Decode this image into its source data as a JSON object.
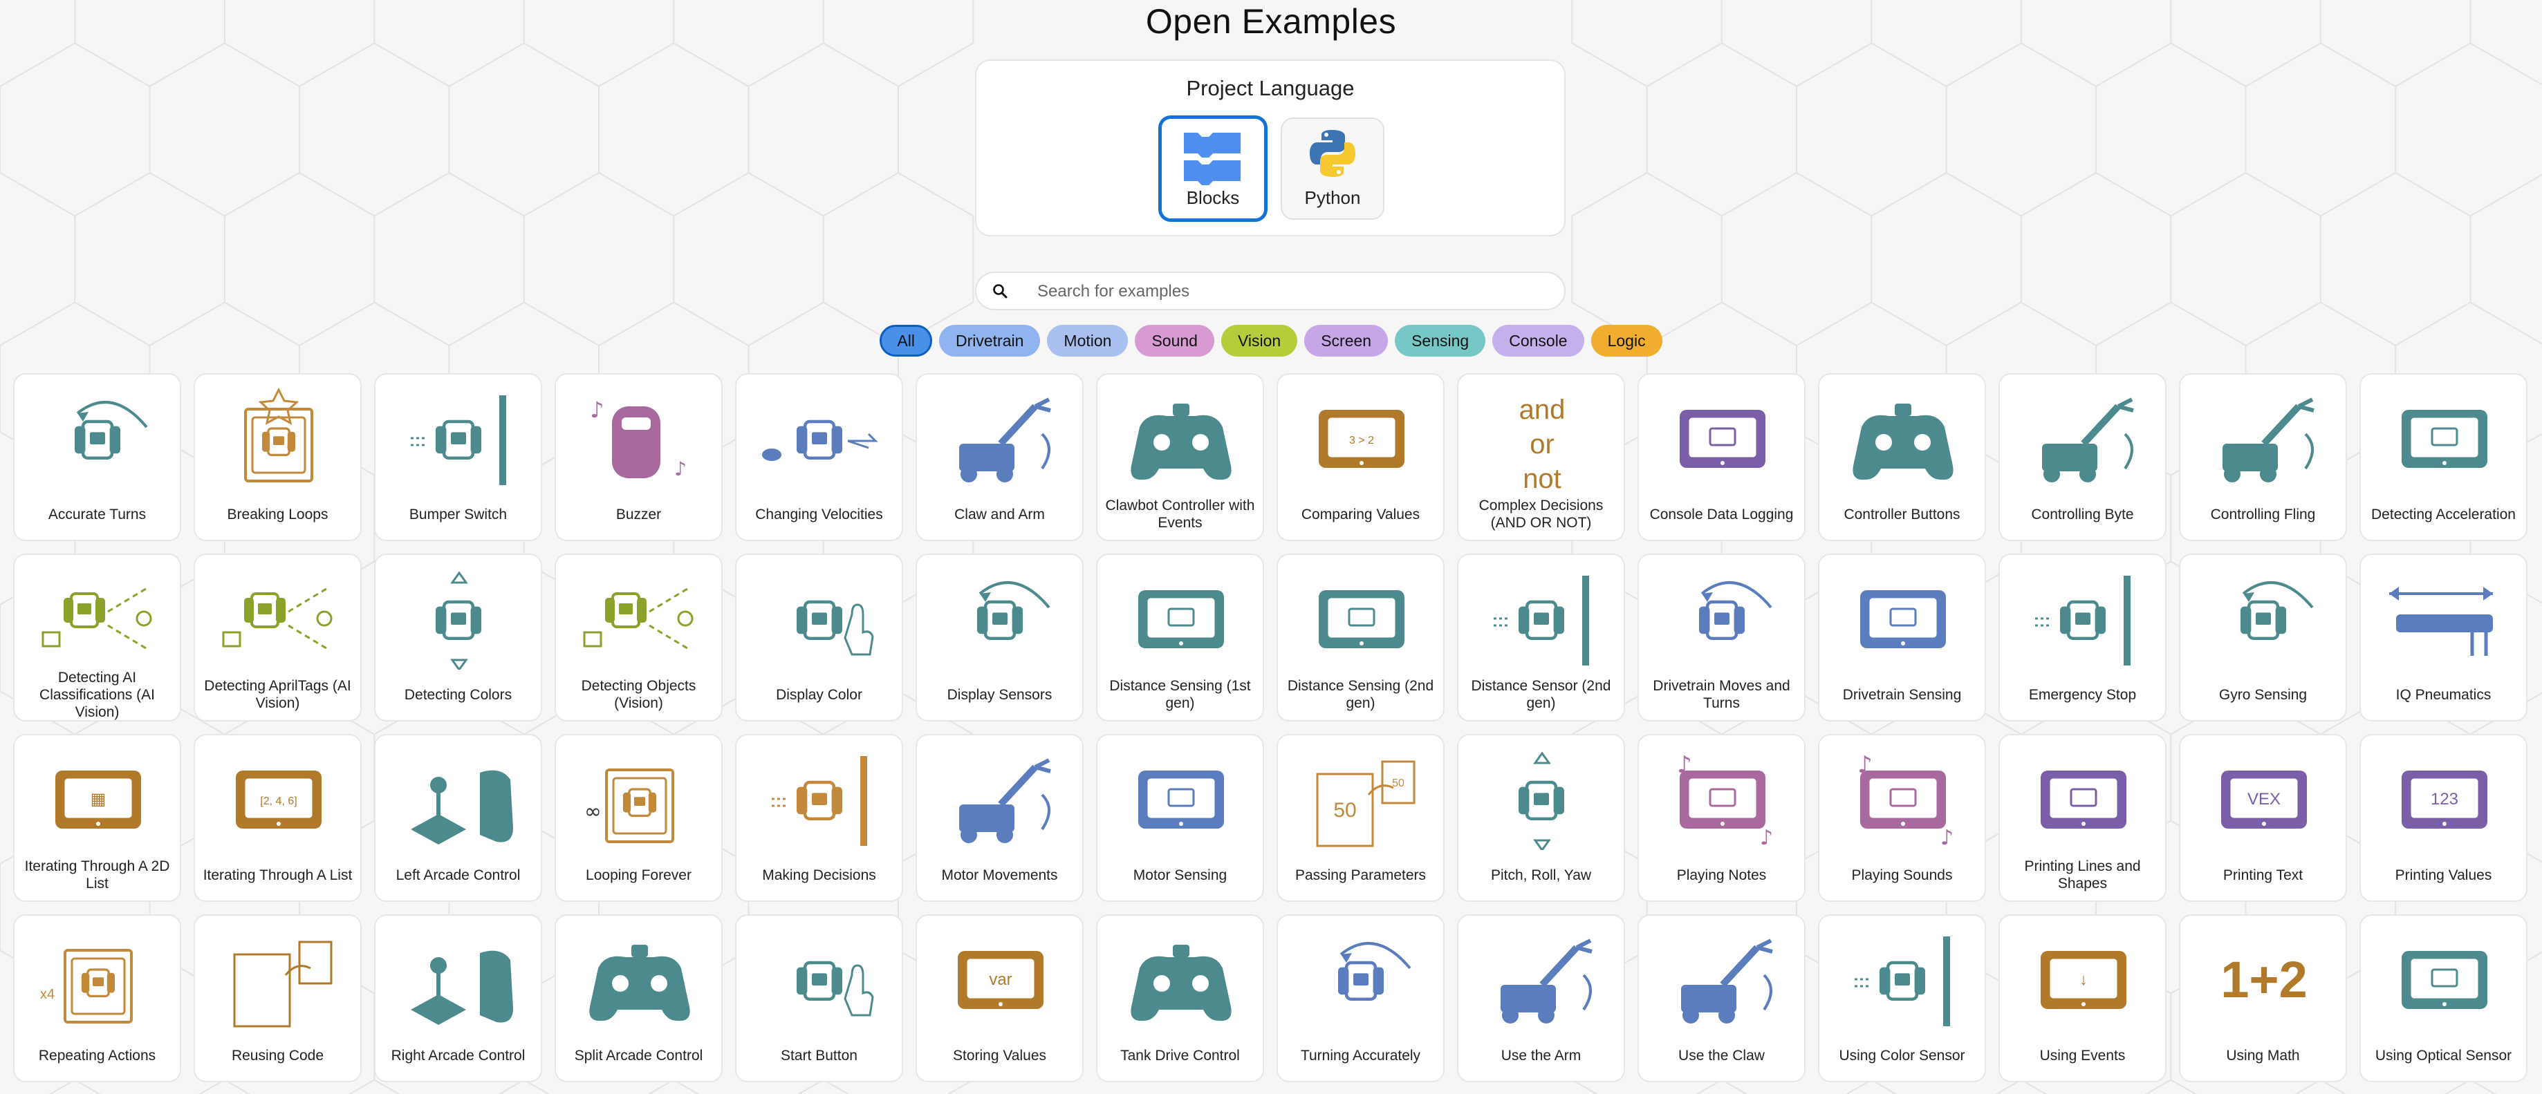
{
  "page_title": "Open Examples",
  "language": {
    "title": "Project Language",
    "options": [
      {
        "label": "Blocks",
        "selected": true
      },
      {
        "label": "Python",
        "selected": false
      }
    ]
  },
  "search": {
    "placeholder": "Search for examples",
    "value": ""
  },
  "filters": [
    {
      "label": "All",
      "color": "#4a90e8",
      "active": true
    },
    {
      "label": "Drivetrain",
      "color": "#8fb4f0",
      "active": false
    },
    {
      "label": "Motion",
      "color": "#a9bff0",
      "active": false
    },
    {
      "label": "Sound",
      "color": "#d79ad3",
      "active": false
    },
    {
      "label": "Vision",
      "color": "#b6cc3a",
      "active": false
    },
    {
      "label": "Screen",
      "color": "#c7a6e8",
      "active": false
    },
    {
      "label": "Sensing",
      "color": "#76c8c6",
      "active": false
    },
    {
      "label": "Console",
      "color": "#c4b0ec",
      "active": false
    },
    {
      "label": "Logic",
      "color": "#f0ad2e",
      "active": false
    }
  ],
  "examples": [
    {
      "name": "Accurate Turns",
      "icon": "turn-robot-icon",
      "color": "#4c8a8e"
    },
    {
      "name": "Breaking Loops",
      "icon": "loop-break-icon",
      "color": "#c2893b"
    },
    {
      "name": "Bumper Switch",
      "icon": "bumper-robot-icon",
      "color": "#4c8a8e"
    },
    {
      "name": "Buzzer",
      "icon": "buzzer-icon",
      "color": "#a86a9e"
    },
    {
      "name": "Changing Velocities",
      "icon": "velocity-robot-icon",
      "color": "#5b7dbd"
    },
    {
      "name": "Claw and Arm",
      "icon": "claw-arm-icon",
      "color": "#5b7dbd"
    },
    {
      "name": "Clawbot Controller with Events",
      "icon": "controller-icon",
      "color": "#4c8a8e"
    },
    {
      "name": "Comparing Values",
      "icon": "brain-screen-icon",
      "color": "#b07a2a",
      "screen_text": "3 > 2"
    },
    {
      "name": "Complex Decisions (AND OR NOT)",
      "icon": "logic-words-icon",
      "color": "#b07a2a",
      "words": [
        "and",
        "or",
        "not"
      ]
    },
    {
      "name": "Console Data Logging",
      "icon": "brain-screen-icon",
      "color": "#7b5ea8",
      "screen_text": ""
    },
    {
      "name": "Controller Buttons",
      "icon": "controller-icon",
      "color": "#4c8a8e"
    },
    {
      "name": "Controlling Byte",
      "icon": "byte-robot-icon",
      "color": "#4c8a8e"
    },
    {
      "name": "Controlling Fling",
      "icon": "fling-robot-icon",
      "color": "#4c8a8e"
    },
    {
      "name": "Detecting Acceleration",
      "icon": "brain-screen-icon",
      "color": "#4c8a8e",
      "screen_text": ""
    },
    {
      "name": "Detecting AI Classifications (AI Vision)",
      "icon": "ai-vision-icon",
      "color": "#8aa22a"
    },
    {
      "name": "Detecting AprilTags (AI Vision)",
      "icon": "ai-vision-icon",
      "color": "#8aa22a"
    },
    {
      "name": "Detecting Colors",
      "icon": "color-sensor-robot-icon",
      "color": "#4c8a8e"
    },
    {
      "name": "Detecting Objects (Vision)",
      "icon": "ai-vision-icon",
      "color": "#8aa22a"
    },
    {
      "name": "Display Color",
      "icon": "touch-robot-icon",
      "color": "#4c8a8e"
    },
    {
      "name": "Display Sensors",
      "icon": "gyro-robot-icon",
      "color": "#4c8a8e"
    },
    {
      "name": "Distance Sensing (1st gen)",
      "icon": "brain-screen-icon",
      "color": "#4c8a8e",
      "screen_text": ""
    },
    {
      "name": "Distance Sensing (2nd gen)",
      "icon": "brain-screen-icon",
      "color": "#4c8a8e",
      "screen_text": ""
    },
    {
      "name": "Distance Sensor (2nd gen)",
      "icon": "distance-robot-icon",
      "color": "#4c8a8e"
    },
    {
      "name": "Drivetrain Moves and Turns",
      "icon": "turn-robot-icon",
      "color": "#5b7dbd"
    },
    {
      "name": "Drivetrain Sensing",
      "icon": "brain-screen-icon",
      "color": "#5b7dbd",
      "screen_text": ""
    },
    {
      "name": "Emergency Stop",
      "icon": "bumper-robot-icon",
      "color": "#4c8a8e"
    },
    {
      "name": "Gyro Sensing",
      "icon": "gyro-robot-icon",
      "color": "#4c8a8e"
    },
    {
      "name": "IQ Pneumatics",
      "icon": "pneumatics-icon",
      "color": "#5b7dbd"
    },
    {
      "name": "Iterating Through A 2D List",
      "icon": "brain-screen-icon",
      "color": "#b07a2a",
      "screen_text": "▦"
    },
    {
      "name": "Iterating Through A List",
      "icon": "brain-screen-icon",
      "color": "#b07a2a",
      "screen_text": "[2, 4, 6]"
    },
    {
      "name": "Left Arcade Control",
      "icon": "joystick-icon",
      "color": "#4c8a8e"
    },
    {
      "name": "Looping Forever",
      "icon": "loop-forever-icon",
      "color": "#c2893b"
    },
    {
      "name": "Making Decisions",
      "icon": "bumper-robot-icon",
      "color": "#c2893b"
    },
    {
      "name": "Motor Movements",
      "icon": "arm-motion-icon",
      "color": "#5b7dbd"
    },
    {
      "name": "Motor Sensing",
      "icon": "brain-screen-icon",
      "color": "#5b7dbd",
      "screen_text": ""
    },
    {
      "name": "Passing Parameters",
      "icon": "document-icon",
      "color": "#c2893b",
      "screen_text": "50"
    },
    {
      "name": "Pitch, Roll, Yaw",
      "icon": "pitch-robot-icon",
      "color": "#4c8a8e"
    },
    {
      "name": "Playing Notes",
      "icon": "sound-screen-icon",
      "color": "#a86a9e"
    },
    {
      "name": "Playing Sounds",
      "icon": "sound-screen-icon",
      "color": "#a86a9e"
    },
    {
      "name": "Printing Lines and Shapes",
      "icon": "brain-screen-icon",
      "color": "#7b5ea8",
      "screen_text": ""
    },
    {
      "name": "Printing Text",
      "icon": "brain-screen-icon",
      "color": "#7b5ea8",
      "screen_text": "VEX"
    },
    {
      "name": "Printing Values",
      "icon": "brain-screen-icon",
      "color": "#7b5ea8",
      "screen_text": "123"
    },
    {
      "name": "Repeating Actions",
      "icon": "loop-repeat-icon",
      "color": "#c2893b"
    },
    {
      "name": "Reusing Code",
      "icon": "document-icon",
      "color": "#b07a2a",
      "screen_text": ""
    },
    {
      "name": "Right Arcade Control",
      "icon": "joystick-icon",
      "color": "#4c8a8e"
    },
    {
      "name": "Split Arcade Control",
      "icon": "controller-icon",
      "color": "#4c8a8e"
    },
    {
      "name": "Start Button",
      "icon": "touch-robot-icon",
      "color": "#4c8a8e"
    },
    {
      "name": "Storing Values",
      "icon": "brain-screen-icon",
      "color": "#b07a2a",
      "screen_text": "var"
    },
    {
      "name": "Tank Drive Control",
      "icon": "controller-icon",
      "color": "#4c8a8e"
    },
    {
      "name": "Turning Accurately",
      "icon": "turn-robot-icon",
      "color": "#5b7dbd"
    },
    {
      "name": "Use the Arm",
      "icon": "arm-motion-icon",
      "color": "#5b7dbd"
    },
    {
      "name": "Use the Claw",
      "icon": "claw-icon",
      "color": "#5b7dbd"
    },
    {
      "name": "Using Color Sensor",
      "icon": "distance-robot-icon",
      "color": "#4c8a8e"
    },
    {
      "name": "Using Events",
      "icon": "brain-screen-icon",
      "color": "#b07a2a",
      "screen_text": "↓"
    },
    {
      "name": "Using Math",
      "icon": "math-icon",
      "color": "#b07a2a",
      "screen_text": "1+2"
    },
    {
      "name": "Using Optical Sensor",
      "icon": "brain-screen-icon",
      "color": "#4c8a8e",
      "screen_text": ""
    }
  ]
}
